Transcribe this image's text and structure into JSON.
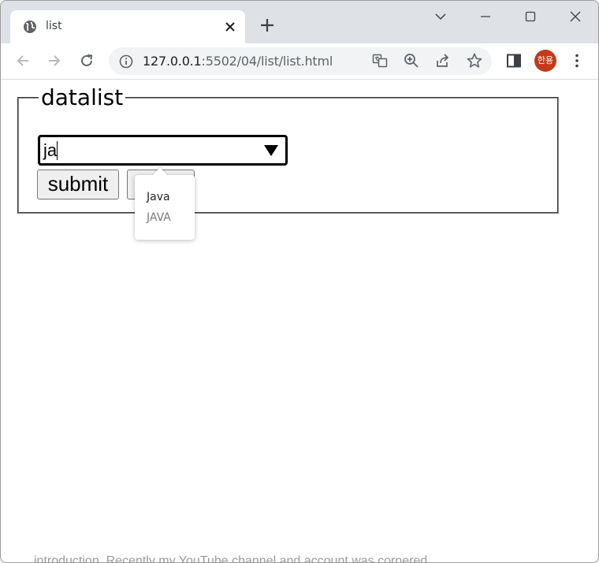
{
  "tab": {
    "title": "list",
    "favicon": "globe-icon"
  },
  "address_bar": {
    "host": "127.0.0.1",
    "path": ":5502/04/list/list.html"
  },
  "profile": {
    "avatar_text": "한용",
    "color": "#c5391b"
  },
  "form": {
    "legend": "datalist",
    "input_value": "ja",
    "submit_label": "submit",
    "reset_label": ""
  },
  "datalist_options": [
    {
      "label": "Java"
    },
    {
      "label": "JAVA"
    }
  ],
  "background_text": "introduction. Recently my YouTube channel and account was cornered."
}
